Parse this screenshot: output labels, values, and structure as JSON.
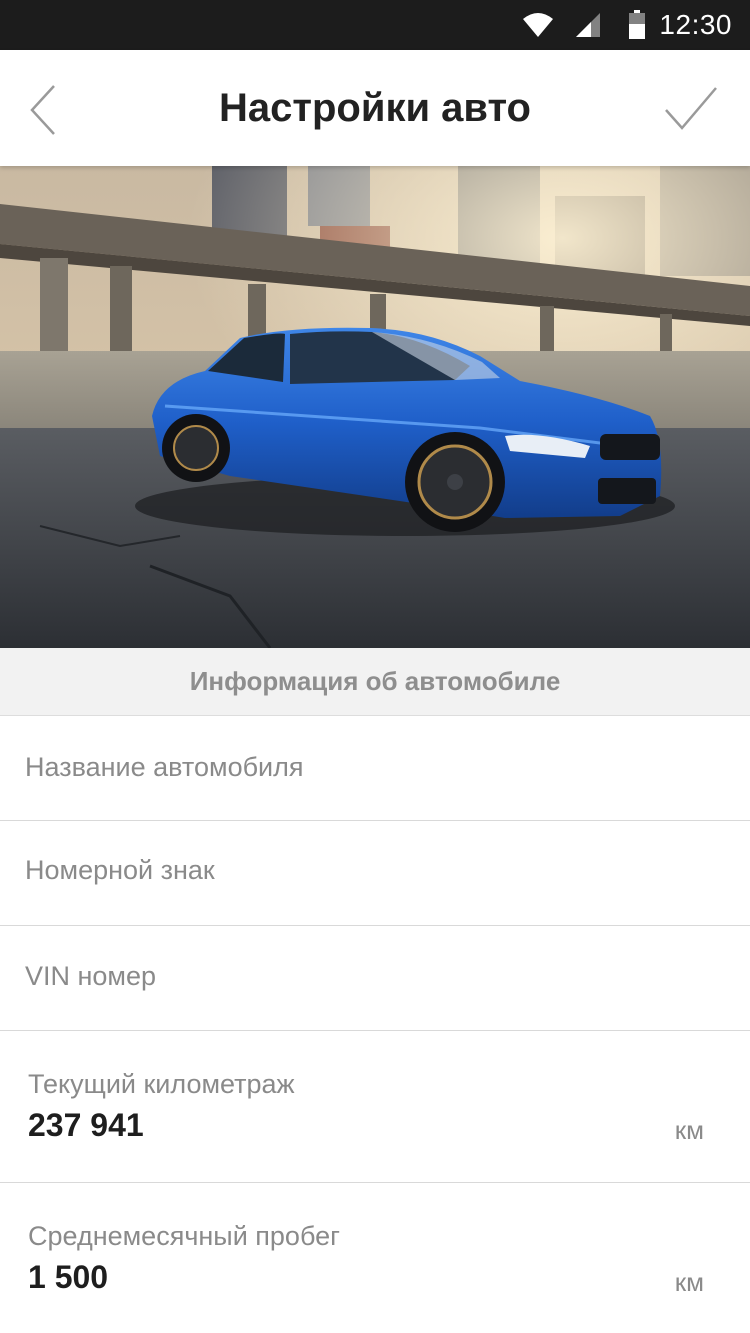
{
  "status_bar": {
    "time": "12:30",
    "icons": [
      "wifi-icon",
      "cell-signal-icon",
      "battery-icon"
    ]
  },
  "app_bar": {
    "title": "Настройки авто",
    "back_icon": "chevron-left-icon",
    "confirm_icon": "checkmark-icon"
  },
  "hero": {
    "description_icon": "car-photo",
    "car_color": "#1f5fc9"
  },
  "section": {
    "title": "Информация об автомобиле"
  },
  "fields": {
    "name": {
      "placeholder": "Название автомобиля"
    },
    "plate": {
      "placeholder": "Номерной знак"
    },
    "vin": {
      "placeholder": "VIN номер"
    },
    "mileage": {
      "label": "Текущий километраж",
      "value": "237 941",
      "unit": "км"
    },
    "monthly": {
      "label": "Среднемесячный пробег",
      "value": "1 500",
      "unit": "км"
    }
  },
  "colors": {
    "status_bar": "#1c1c1c",
    "section_bg": "#f2f2f2",
    "label": "#8a8a8a",
    "value": "#1e1e1e"
  }
}
